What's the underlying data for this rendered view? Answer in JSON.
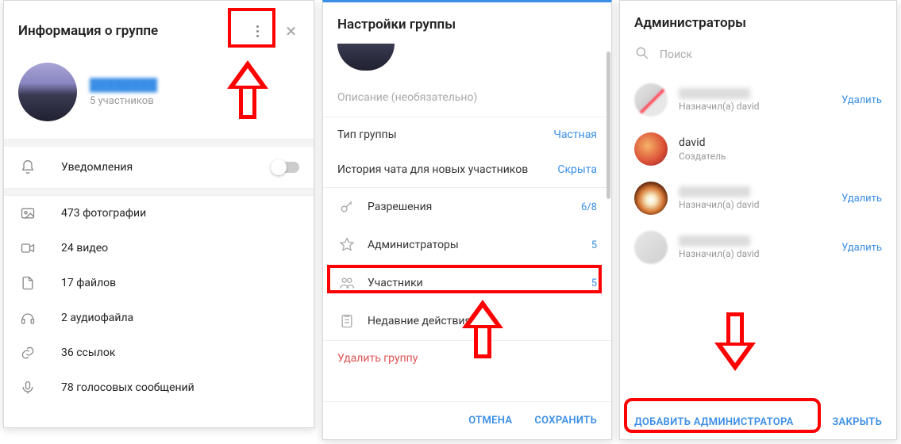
{
  "pane1": {
    "title": "Информация о группе",
    "group_name": "████████",
    "members": "5 участников",
    "notifications_label": "Уведомления",
    "media": [
      {
        "icon": "photo-icon",
        "label": "473 фотографии"
      },
      {
        "icon": "video-icon",
        "label": "24 видео"
      },
      {
        "icon": "file-icon",
        "label": "17 файлов"
      },
      {
        "icon": "audio-icon",
        "label": "2 аудиофайла"
      },
      {
        "icon": "link-icon-li",
        "label": "36 ссылок"
      },
      {
        "icon": "voice-icon",
        "label": "78 голосовых сообщений"
      }
    ]
  },
  "pane2": {
    "title": "Настройки группы",
    "description_placeholder": "Описание (необязательно)",
    "kv": [
      {
        "k": "Тип группы",
        "v": "Частная"
      },
      {
        "k": "История чата для новых участников",
        "v": "Скрыта"
      }
    ],
    "items": [
      {
        "icon": "key-icon",
        "label": "Разрешения",
        "count": "6/8"
      },
      {
        "icon": "star-icon",
        "label": "Администраторы",
        "count": "5"
      },
      {
        "icon": "members-icon",
        "label": "Участники",
        "count": "5"
      },
      {
        "icon": "recent-icon",
        "label": "Недавние действия",
        "count": ""
      }
    ],
    "delete_label": "Удалить группу",
    "cancel_label": "ОТМЕНА",
    "save_label": "СОХРАНИТЬ"
  },
  "pane3": {
    "title": "Администраторы",
    "search_placeholder": "Поиск",
    "admins": [
      {
        "name_blur": true,
        "name": "",
        "sub": "Назначил(а) david",
        "deletable": true
      },
      {
        "name_blur": false,
        "name": "david",
        "sub": "Создатель",
        "deletable": false
      },
      {
        "name_blur": true,
        "name": "",
        "sub": "Назначил(а) david",
        "deletable": true
      },
      {
        "name_blur": true,
        "name": "",
        "sub": "Назначил(а) david",
        "deletable": true
      }
    ],
    "delete_label": "Удалить",
    "add_label": "ДОБАВИТЬ АДМИНИСТРАТОРА",
    "close_label": "ЗАКРЫТЬ"
  }
}
